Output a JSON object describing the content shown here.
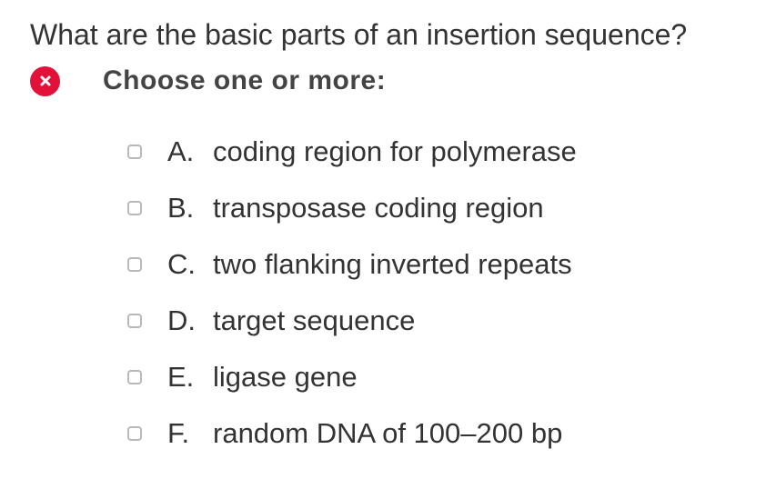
{
  "question": {
    "text": "What are the basic parts of an insertion sequence?"
  },
  "status": {
    "icon": "x-circle-icon",
    "color": "#e3103a"
  },
  "instruction": "Choose one or more:",
  "options": [
    {
      "letter": "A.",
      "text": "coding region for polymerase",
      "checked": false
    },
    {
      "letter": "B.",
      "text": "transposase coding region",
      "checked": false
    },
    {
      "letter": "C.",
      "text": "two flanking inverted repeats",
      "checked": false
    },
    {
      "letter": "D.",
      "text": "target sequence",
      "checked": false
    },
    {
      "letter": "E.",
      "text": "ligase gene",
      "checked": false
    },
    {
      "letter": "F.",
      "text": "random DNA of 100–200 bp",
      "checked": false
    }
  ]
}
